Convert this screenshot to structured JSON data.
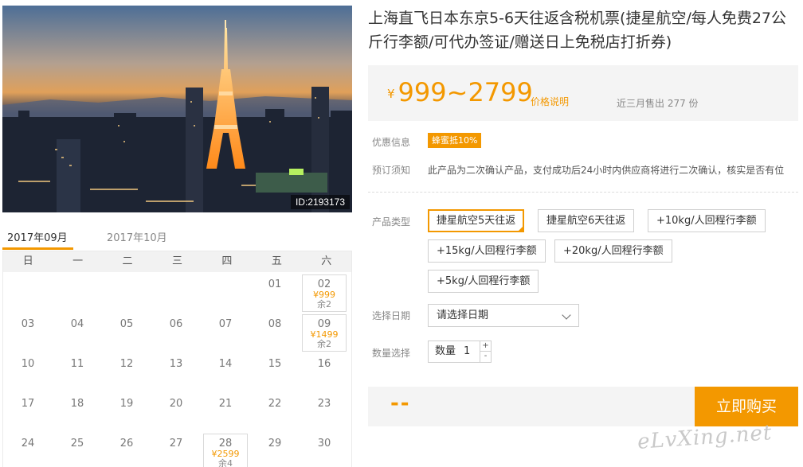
{
  "photo": {
    "id_label": "ID:2193173"
  },
  "calendar": {
    "tabs": [
      {
        "label": "2017年09月",
        "active": true
      },
      {
        "label": "2017年10月",
        "active": false
      }
    ],
    "weekdays": [
      "日",
      "一",
      "二",
      "三",
      "四",
      "五",
      "六"
    ],
    "days": [
      {
        "d": ""
      },
      {
        "d": ""
      },
      {
        "d": ""
      },
      {
        "d": ""
      },
      {
        "d": ""
      },
      {
        "d": "01"
      },
      {
        "d": "02",
        "price": "¥999",
        "stock": "余2"
      },
      {
        "d": "03"
      },
      {
        "d": "04"
      },
      {
        "d": "05"
      },
      {
        "d": "06"
      },
      {
        "d": "07"
      },
      {
        "d": "08"
      },
      {
        "d": "09",
        "price": "¥1499",
        "stock": "余2"
      },
      {
        "d": "10"
      },
      {
        "d": "11"
      },
      {
        "d": "12"
      },
      {
        "d": "13"
      },
      {
        "d": "14"
      },
      {
        "d": "15"
      },
      {
        "d": "16"
      },
      {
        "d": "17"
      },
      {
        "d": "18"
      },
      {
        "d": "19"
      },
      {
        "d": "20"
      },
      {
        "d": "21"
      },
      {
        "d": "22"
      },
      {
        "d": "23"
      },
      {
        "d": "24"
      },
      {
        "d": "25"
      },
      {
        "d": "26"
      },
      {
        "d": "27"
      },
      {
        "d": "28",
        "price": "¥2599",
        "stock": "余4"
      },
      {
        "d": "29"
      },
      {
        "d": "30"
      }
    ]
  },
  "product": {
    "title": "上海直飞日本东京5-6天往返含税机票(捷星航空/每人免费27公斤行李额/可代办签证/赠送日上免税店打折券)",
    "price_currency": "¥",
    "price_range": "999~2799",
    "price_note": "价格说明",
    "sold_text": "近三月售出 277 份"
  },
  "labels": {
    "discount": "优惠信息",
    "notice": "预订须知",
    "type": "产品类型",
    "date": "选择日期",
    "quantity": "数量选择"
  },
  "discount_badge": "蜂蜜抵10%",
  "notice_text": "此产品为二次确认产品，支付成功后24小时内供应商将进行二次确认，核实是否有位",
  "options": [
    {
      "label": "捷星航空5天往返",
      "selected": true
    },
    {
      "label": "捷星航空6天往返",
      "selected": false
    },
    {
      "label": "+10kg/人回程行李额",
      "selected": false
    },
    {
      "label": "+15kg/人回程行李额",
      "selected": false
    },
    {
      "label": "+20kg/人回程行李额",
      "selected": false
    },
    {
      "label": "+5kg/人回程行李额",
      "selected": false
    }
  ],
  "date_select": {
    "placeholder": "请选择日期"
  },
  "quantity": {
    "label": "数量",
    "value": "1",
    "up": "+",
    "down": "-"
  },
  "total": "--",
  "buy_button": "立即购买",
  "watermark": "eLvXing.net",
  "colors": {
    "accent": "#f39800",
    "panel": "#f4f4f4"
  }
}
